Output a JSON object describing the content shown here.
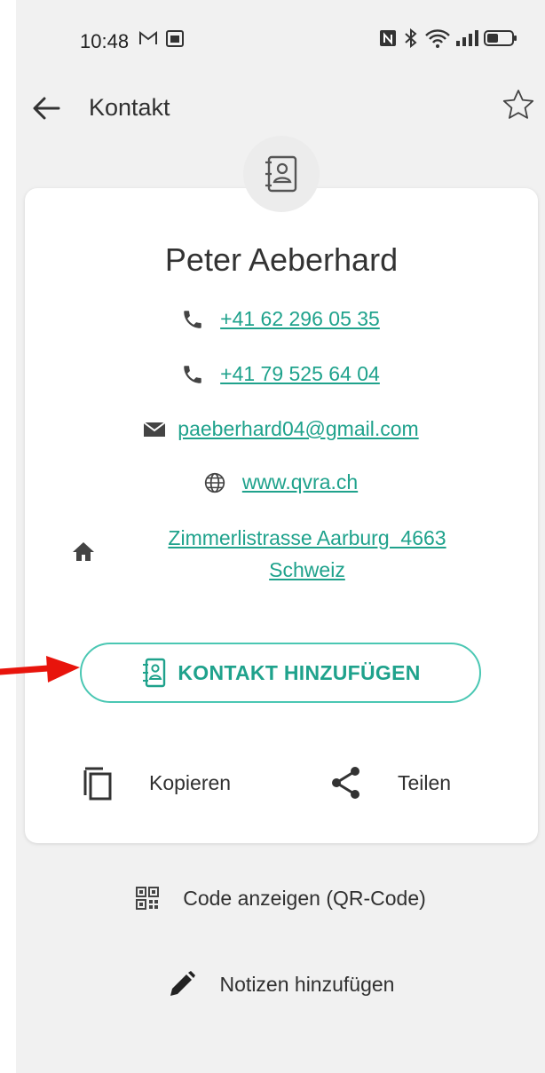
{
  "status_bar": {
    "time": "10:48"
  },
  "header": {
    "title": "Kontakt"
  },
  "contact": {
    "name": "Peter Aeberhard",
    "phone1": "+41 62 296 05 35",
    "phone2": "+41 79 525 64 04",
    "email": "paeberhard04@gmail.com",
    "website": "www.qvra.ch",
    "address_line1": "Zimmerlistrasse Aarburg  4663",
    "address_line2": "Schweiz"
  },
  "actions": {
    "add_contact": "KONTAKT HINZUFÜGEN",
    "copy": "Kopieren",
    "share": "Teilen",
    "show_code": "Code anzeigen (QR-Code)",
    "add_notes": "Notizen hinzufügen"
  },
  "colors": {
    "accent": "#1fa28c",
    "button_border": "#4ac7b3",
    "arrow": "#e8140c",
    "background": "#f1f1f1"
  }
}
